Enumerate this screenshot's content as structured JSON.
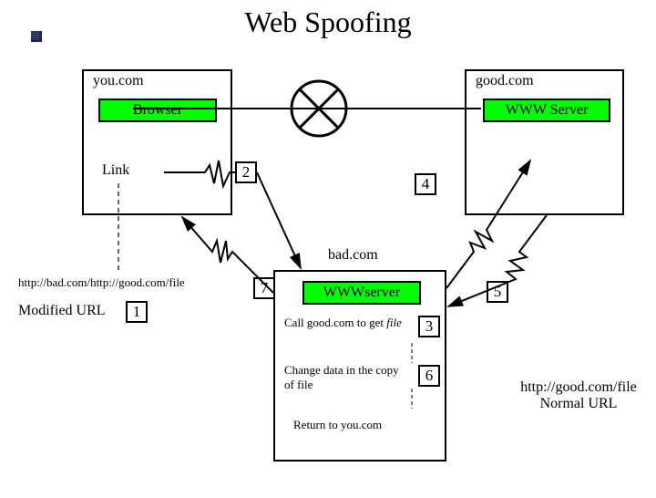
{
  "title": "Web Spoofing",
  "left_host": "you.com",
  "right_host": "good.com",
  "browser_label": "Browser",
  "www_server_label": "WWW Server",
  "link_label": "Link",
  "modified_url_text": "http://bad.com/http://good.com/file",
  "modified_url_label": "Modified URL",
  "bad_host": "bad.com",
  "bad_server_label": "WWWserver",
  "step_call": "Call good.com to get ",
  "step_call_file": "file",
  "step_change": "Change data in the copy of file",
  "step_return": "Return to you.com",
  "normal_url_line1": "http://good.com/file",
  "normal_url_line2": "Normal URL",
  "steps": {
    "s1": "1",
    "s2": "2",
    "s3": "3",
    "s4": "4",
    "s5": "5",
    "s6": "6",
    "s7": "7"
  }
}
